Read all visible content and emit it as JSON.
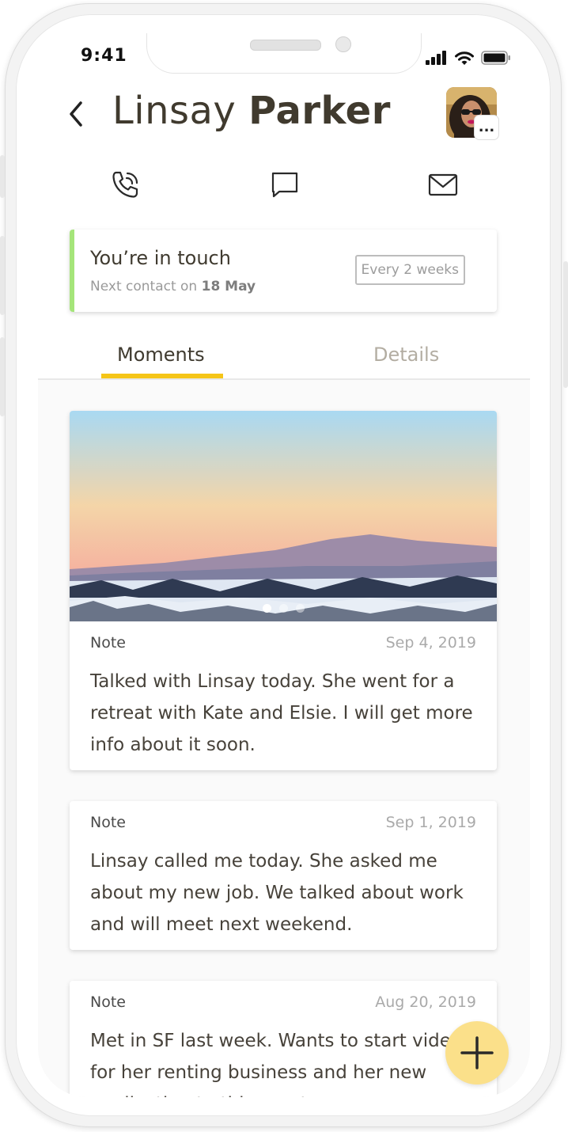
{
  "status_bar": {
    "time": "9:41"
  },
  "header": {
    "first_name": "Linsay",
    "last_name": "Parker",
    "avatar_more": "..."
  },
  "touch": {
    "title": "You’re in touch",
    "next_prefix": "Next contact on",
    "next_date": "18 May",
    "frequency": "Every 2 weeks",
    "accent_color": "#a5e57a"
  },
  "tabs": [
    {
      "label": "Moments",
      "active": true
    },
    {
      "label": "Details",
      "active": false
    }
  ],
  "tab_accent_color": "#f5c518",
  "moments": [
    {
      "type": "Note",
      "date": "Sep 4, 2019",
      "text": "Talked with Linsay today. She went for a retreat with Kate and Elsie. I will get more info about it soon.",
      "has_photo": true,
      "photo_pages": 3,
      "photo_active": 1
    },
    {
      "type": "Note",
      "date": "Sep 1, 2019",
      "text": "Linsay called me today. She asked me about my new job. We talked about work and will meet next weekend.",
      "has_photo": false
    },
    {
      "type": "Note",
      "date": "Aug 20, 2019",
      "text": "Met in SF last week. Wants to start videos for her renting business and her new application to this great app.",
      "has_photo": false
    }
  ],
  "icons": [
    "back-icon",
    "phone-call-icon",
    "message-icon",
    "mail-icon",
    "signal-icon",
    "wifi-icon",
    "battery-icon",
    "add-icon"
  ],
  "fab_color": "#fbe08a"
}
